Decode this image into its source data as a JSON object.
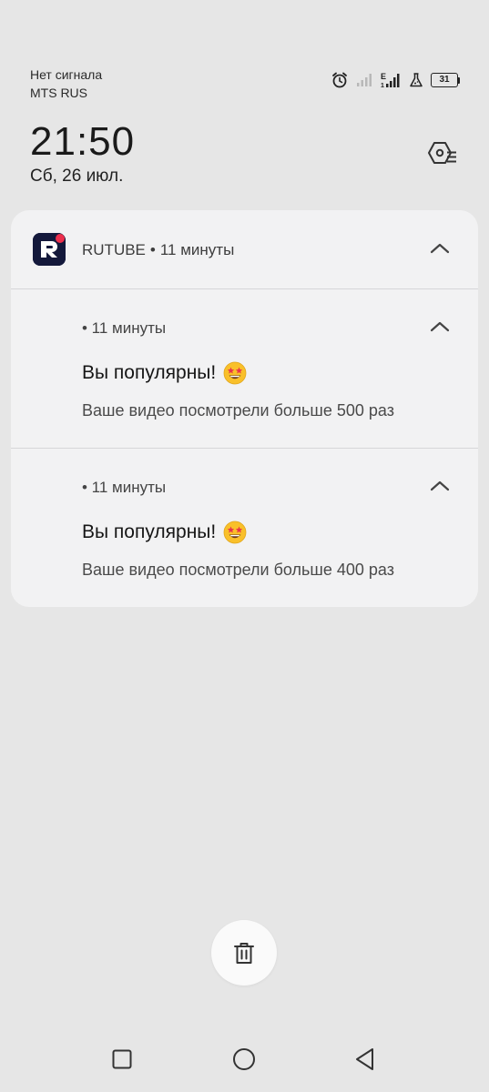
{
  "status_bar": {
    "network_status": "Нет сигнала",
    "carrier": "MTS RUS",
    "network_type": "E",
    "sim_slot": "1",
    "battery_level": "31",
    "icons": [
      "alarm-icon",
      "signal-empty-icon",
      "signal-e-icon",
      "flask-icon",
      "battery-icon"
    ]
  },
  "lock": {
    "time": "21:50",
    "date": "Сб, 26 июл."
  },
  "notification_group": {
    "app_name": "RUTUBE",
    "separator": "•",
    "age": "11 минуты",
    "app_icon_letter": "R",
    "accent_color": "#ed2f4c",
    "icon_bg_color": "#14193b",
    "notifications": [
      {
        "time": "• 11 минуты",
        "title": "Вы популярны!",
        "emoji": "star-struck-emoji",
        "body": "Ваше видео посмотрели больше 500 раз"
      },
      {
        "time": "• 11 минуты",
        "title": "Вы популярны!",
        "emoji": "star-struck-emoji",
        "body": "Ваше видео посмотрели больше 400 раз"
      }
    ]
  },
  "actions": {
    "clear_all_icon": "trash-icon"
  },
  "navigation": {
    "buttons": [
      "recents-square-icon",
      "home-circle-icon",
      "back-triangle-icon"
    ]
  }
}
